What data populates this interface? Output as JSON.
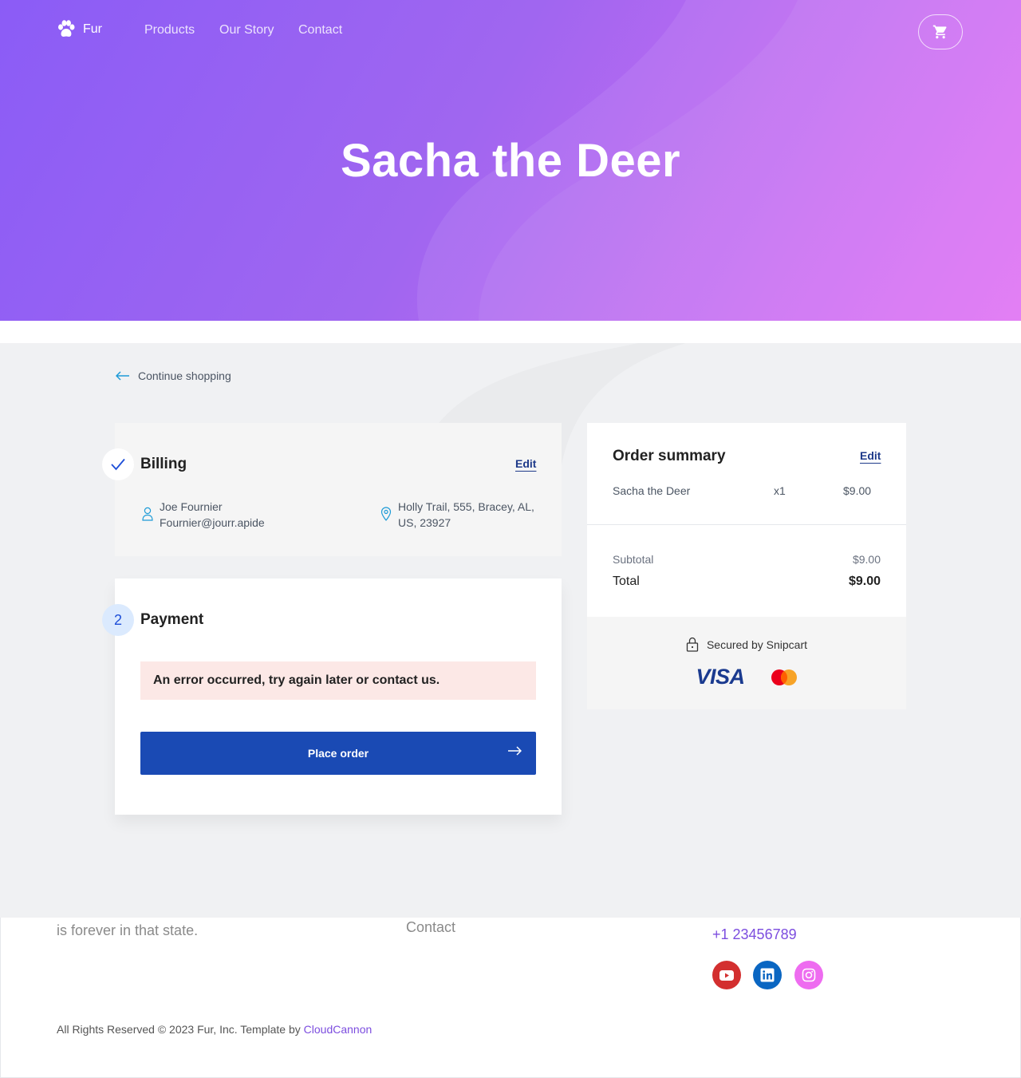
{
  "brand": {
    "name": "Fur"
  },
  "nav": {
    "items": [
      "Products",
      "Our Story",
      "Contact"
    ]
  },
  "hero": {
    "title": "Sacha the Deer"
  },
  "checkout": {
    "continue_label": "Continue shopping",
    "billing": {
      "title": "Billing",
      "edit_label": "Edit",
      "name": "Joe Fournier",
      "email": "Fournier@jourr.apide",
      "address_line1": "Holly Trail, 555, Bracey, AL,",
      "address_line2": "US, 23927"
    },
    "payment": {
      "step": "2",
      "title": "Payment",
      "error": "An error occurred, try again later or contact us.",
      "button_label": "Place order"
    },
    "summary": {
      "title": "Order summary",
      "edit_label": "Edit",
      "item_name": "Sacha the Deer",
      "item_qty": "x1",
      "item_price": "$9.00",
      "subtotal_label": "Subtotal",
      "subtotal_value": "$9.00",
      "total_label": "Total",
      "total_value": "$9.00"
    },
    "secured": {
      "label": "Secured by Snipcart",
      "visa": "VISA"
    }
  },
  "footer": {
    "tagline_fragment": "is forever in that state.",
    "contact_link": "Contact",
    "phone": "+1 23456789",
    "copyright_prefix": "All Rights Reserved © 2023 Fur, Inc. Template by ",
    "copyright_link": "CloudCannon"
  },
  "colors": {
    "hero_start": "#8b5cf6",
    "hero_end": "#e06ef4",
    "primary_button": "#1a4ab4",
    "error_bg": "#fce8e6",
    "accent_link": "#7c4ddf",
    "youtube": "#d32f2f",
    "linkedin": "#0a66c2",
    "instagram": "#ee6cf0"
  }
}
